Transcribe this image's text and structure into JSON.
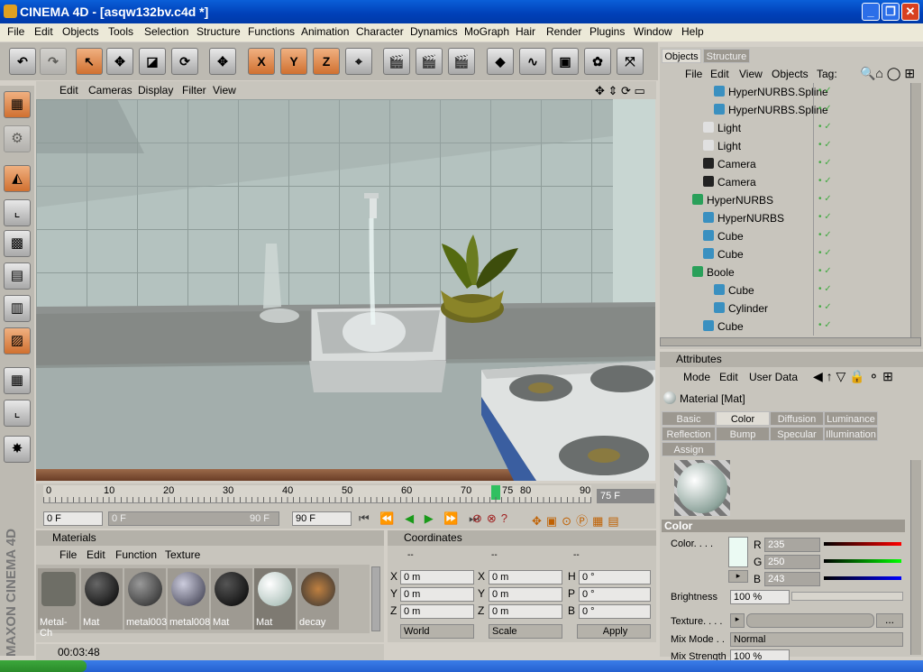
{
  "window": {
    "title": "CINEMA 4D - [asqw132bv.c4d *]",
    "buttons": [
      "_",
      "❐",
      "✕"
    ]
  },
  "menubar": [
    "File",
    "Edit",
    "Objects",
    "Tools",
    "Selection",
    "Structure",
    "Functions",
    "Animation",
    "Character",
    "Dynamics",
    "MoGraph",
    "Hair",
    "Render",
    "Plugins",
    "Window",
    "Help"
  ],
  "toolbar": {
    "axes": [
      "X",
      "Y",
      "Z"
    ]
  },
  "viewport": {
    "menu": [
      "Edit",
      "Cameras",
      "Display",
      "Filter",
      "View"
    ]
  },
  "timeline": {
    "ticks": [
      "0",
      "10",
      "20",
      "30",
      "40",
      "50",
      "60",
      "70",
      "75",
      "80",
      "90"
    ],
    "current_frame": "75 F",
    "start": "0 F",
    "range_start": "0 F",
    "range_end": "90 F",
    "end": "90 F"
  },
  "materials": {
    "title": "Materials",
    "menu": [
      "File",
      "Edit",
      "Function",
      "Texture"
    ],
    "items": [
      "Metal-Ch",
      "Mat",
      "metal003",
      "metal008",
      "Mat",
      "Mat",
      "decay"
    ],
    "time": "00:03:48"
  },
  "coords": {
    "title": "Coordinates",
    "rows": [
      {
        "a": "X",
        "av": "0 m",
        "b": "X",
        "bv": "0 m",
        "c": "H",
        "cv": "0 °"
      },
      {
        "a": "Y",
        "av": "0 m",
        "b": "Y",
        "bv": "0 m",
        "c": "P",
        "cv": "0 °"
      },
      {
        "a": "Z",
        "av": "0 m",
        "b": "Z",
        "bv": "0 m",
        "c": "B",
        "cv": "0 °"
      }
    ],
    "dash": [
      "--",
      "--",
      "--"
    ],
    "mode": "World",
    "scale": "Scale",
    "apply": "Apply"
  },
  "objects": {
    "tabs": [
      "Objects",
      "Structure"
    ],
    "menu": [
      "File",
      "Edit",
      "View",
      "Objects",
      "Tag:"
    ],
    "rows": [
      {
        "name": "HyperNURBS.Spline",
        "indent": 2,
        "icon": "spline"
      },
      {
        "name": "HyperNURBS.Spline",
        "indent": 2,
        "icon": "spline"
      },
      {
        "name": "Light",
        "indent": 1,
        "icon": "light"
      },
      {
        "name": "Light",
        "indent": 1,
        "icon": "light"
      },
      {
        "name": "Camera",
        "indent": 1,
        "icon": "camera"
      },
      {
        "name": "Camera",
        "indent": 1,
        "icon": "camera"
      },
      {
        "name": "HyperNURBS",
        "indent": 0,
        "icon": "hypernurbs"
      },
      {
        "name": "HyperNURBS",
        "indent": 1,
        "icon": "cone"
      },
      {
        "name": "Cube",
        "indent": 1,
        "icon": "cube"
      },
      {
        "name": "Cube",
        "indent": 1,
        "icon": "cube"
      },
      {
        "name": "Boole",
        "indent": 0,
        "icon": "boole"
      },
      {
        "name": "Cube",
        "indent": 2,
        "icon": "cube"
      },
      {
        "name": "Cylinder",
        "indent": 2,
        "icon": "cylinder"
      },
      {
        "name": "Cube",
        "indent": 1,
        "icon": "cube"
      }
    ]
  },
  "attributes": {
    "title": "Attributes",
    "menu": [
      "Mode",
      "Edit",
      "User Data"
    ],
    "material": "Material [Mat]",
    "tabs": [
      "Basic",
      "Color",
      "Diffusion",
      "Luminance",
      "Reflection",
      "Bump",
      "Specular",
      "Illumination",
      "Assign"
    ],
    "section": "Color",
    "color_label": "Color. . . .",
    "r": "235",
    "g": "250",
    "b": "243",
    "brightness_label": "Brightness",
    "brightness": "100 %",
    "texture_label": "Texture. . . .",
    "mixmode_label": "Mix Mode . .",
    "mixmode": "Normal",
    "mixstrength_label": "Mix Strength",
    "mixstrength": "100 %",
    "swatch": "#ebfaf3"
  }
}
